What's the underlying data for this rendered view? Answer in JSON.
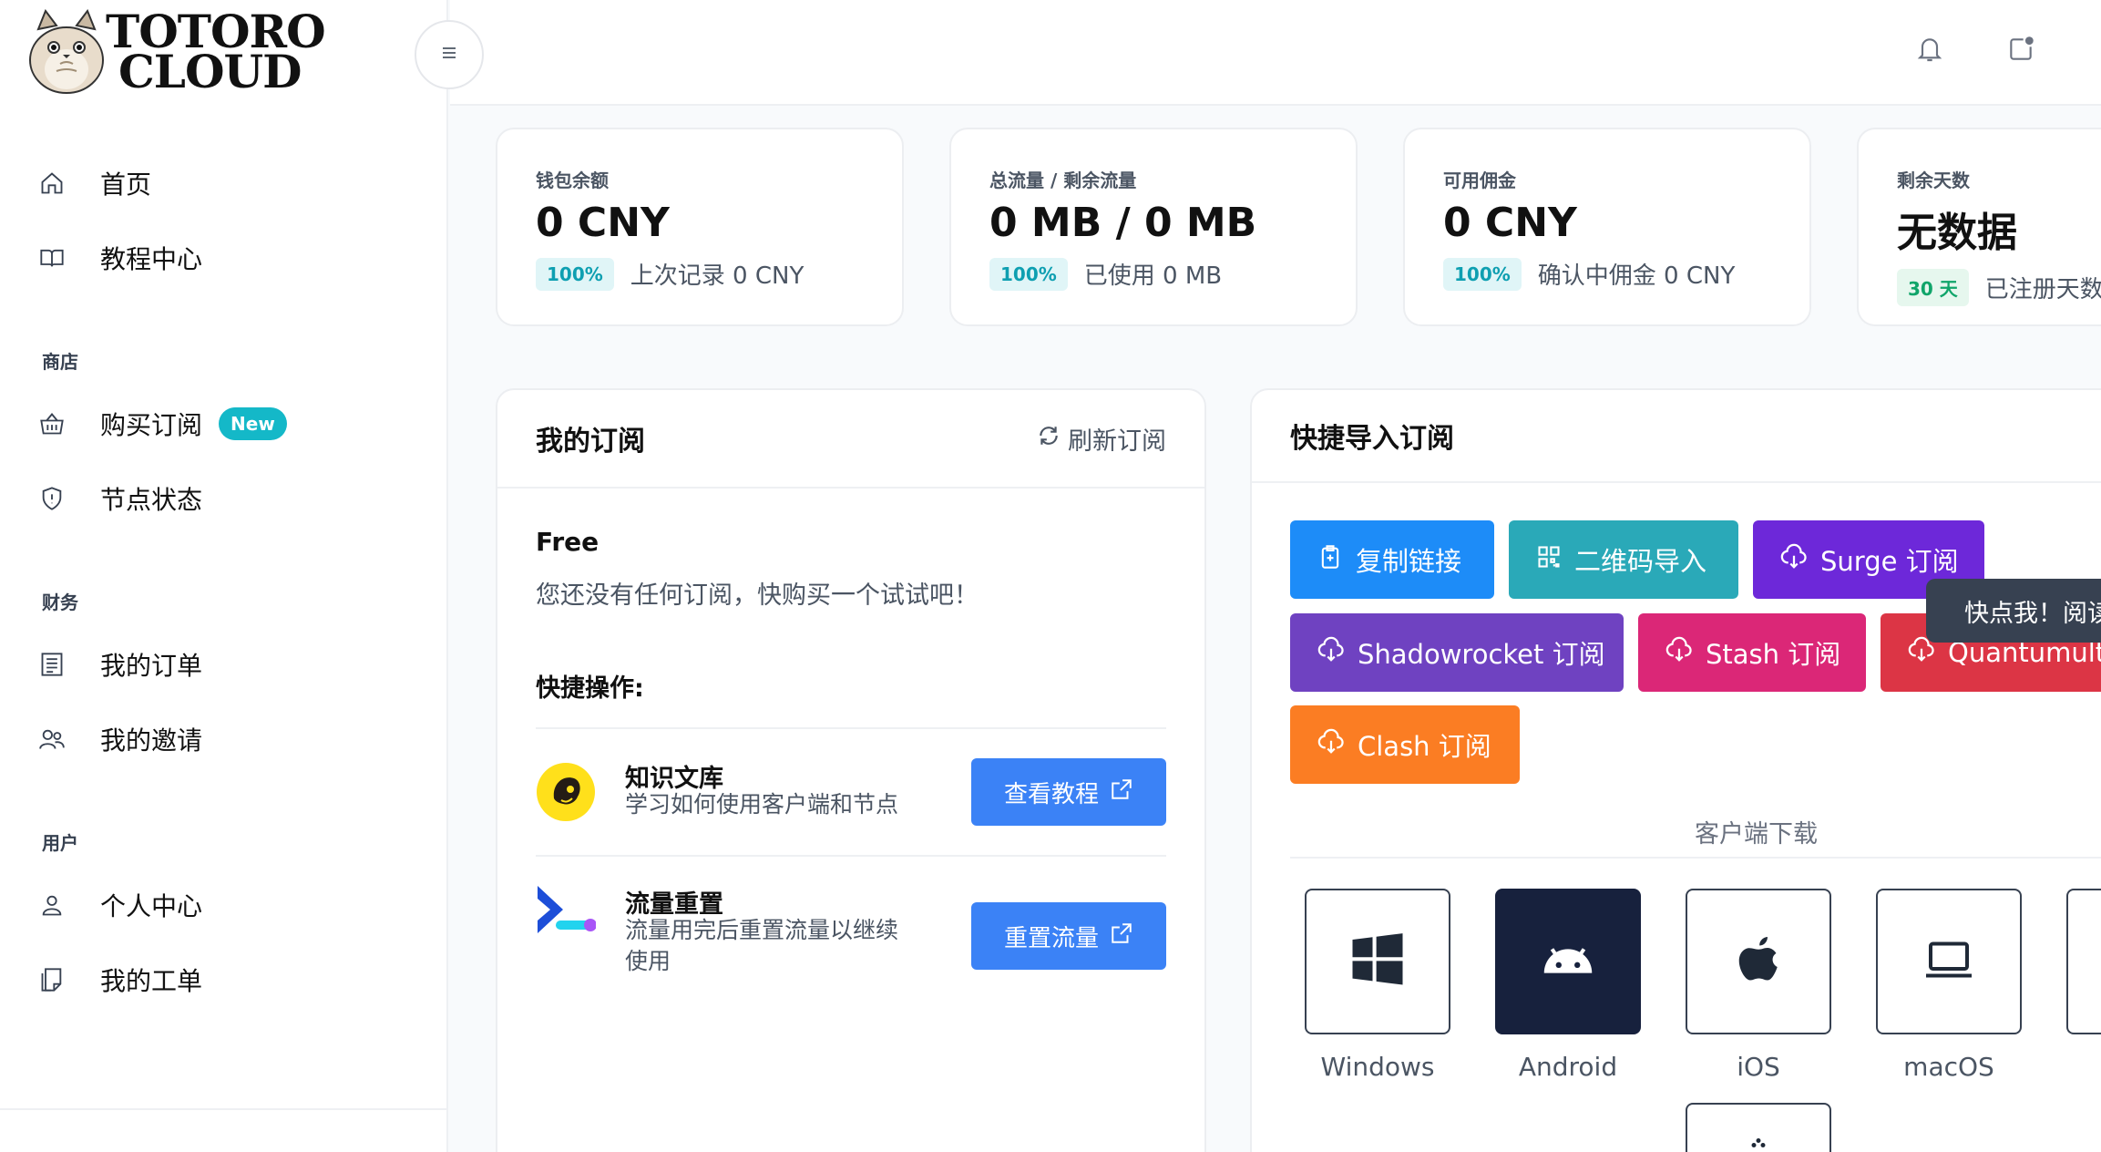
{
  "brand": {
    "line1": "TOTORO",
    "line2": "CLOUD"
  },
  "nav": {
    "home": "首页",
    "tutorials": "教程中心",
    "section_shop": "商店",
    "buy": "购买订阅",
    "buy_badge": "New",
    "node_status": "节点状态",
    "section_finance": "财务",
    "orders": "我的订单",
    "invites": "我的邀请",
    "section_user": "用户",
    "profile": "个人中心",
    "tickets": "我的工单"
  },
  "stats": [
    {
      "label": "钱包余额",
      "value": "0 CNY",
      "pill": "100%",
      "sub": "上次记录 0 CNY"
    },
    {
      "label": "总流量 / 剩余流量",
      "value": "0 MB / 0 MB",
      "pill": "100%",
      "sub": "已使用 0 MB"
    },
    {
      "label": "可用佣金",
      "value": "0 CNY",
      "pill": "100%",
      "sub": "确认中佣金 0 CNY"
    },
    {
      "label": "剩余天数",
      "value": "无数据",
      "pill": "30 天",
      "sub": "已注册天数"
    }
  ],
  "subscription": {
    "title": "我的订阅",
    "refresh": "刷新订阅",
    "plan": "Free",
    "desc": "您还没有任何订阅，快购买一个试试吧！",
    "quick_title": "快捷操作:",
    "actions": [
      {
        "name": "知识文库",
        "desc": "学习如何使用客户端和节点",
        "button": "查看教程"
      },
      {
        "name": "流量重置",
        "desc": "流量用完后重置流量以继续使用",
        "button": "重置流量"
      }
    ]
  },
  "import": {
    "title": "快捷导入订阅",
    "buttons": {
      "copy": "复制链接",
      "qr": "二维码导入",
      "surge": "Surge 订阅",
      "shadowrocket": "Shadowrocket 订阅",
      "stash": "Stash 订阅",
      "quantumult": "Quantumult",
      "clash": "Clash 订阅"
    },
    "tooltip": "快点我！阅读",
    "download_label": "客户端下载",
    "clients": [
      "Windows",
      "Android",
      "iOS",
      "macOS"
    ]
  },
  "colors": {
    "accent": "#3b82f6",
    "teal": "#2aa9b8",
    "purple": "#6d28d9",
    "pink": "#db2777",
    "red": "#dc3545",
    "orange": "#fb7d23",
    "violet": "#6f42c1"
  }
}
